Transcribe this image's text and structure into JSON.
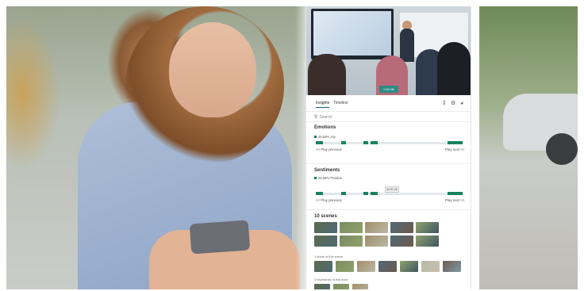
{
  "tabs": {
    "insights": "Insights",
    "timeline": "Timeline"
  },
  "search": {
    "placeholder": "Search"
  },
  "video": {
    "badge": "0:01:08"
  },
  "emotions": {
    "title": "Emotions",
    "metric": "28.58% Joy",
    "play_previous": "<< Play previous",
    "play_next": "Play next >>",
    "segments": [
      0.0,
      0.05,
      0.17,
      0.2,
      0.32,
      0.35,
      0.37,
      0.42,
      0.89,
      0.99
    ]
  },
  "sentiments": {
    "title": "Sentiments",
    "metric": "28.58% Positive",
    "tooltip": "00:01:25",
    "play_previous": "<< Play previous",
    "play_next": "Play next >>",
    "segments": [
      0.0,
      0.05,
      0.17,
      0.2,
      0.32,
      0.35,
      0.37,
      0.42,
      0.89,
      0.99
    ]
  },
  "scenes": {
    "title": "10 scenes",
    "shots_label": "1 shots in this scene",
    "keyframes_label": "3 keyframes in this shot"
  },
  "colors": {
    "accent": "#16825f",
    "tab_underline": "#0f5c8c"
  },
  "icons": [
    "search-icon",
    "download-icon",
    "settings-icon",
    "globe-icon"
  ]
}
